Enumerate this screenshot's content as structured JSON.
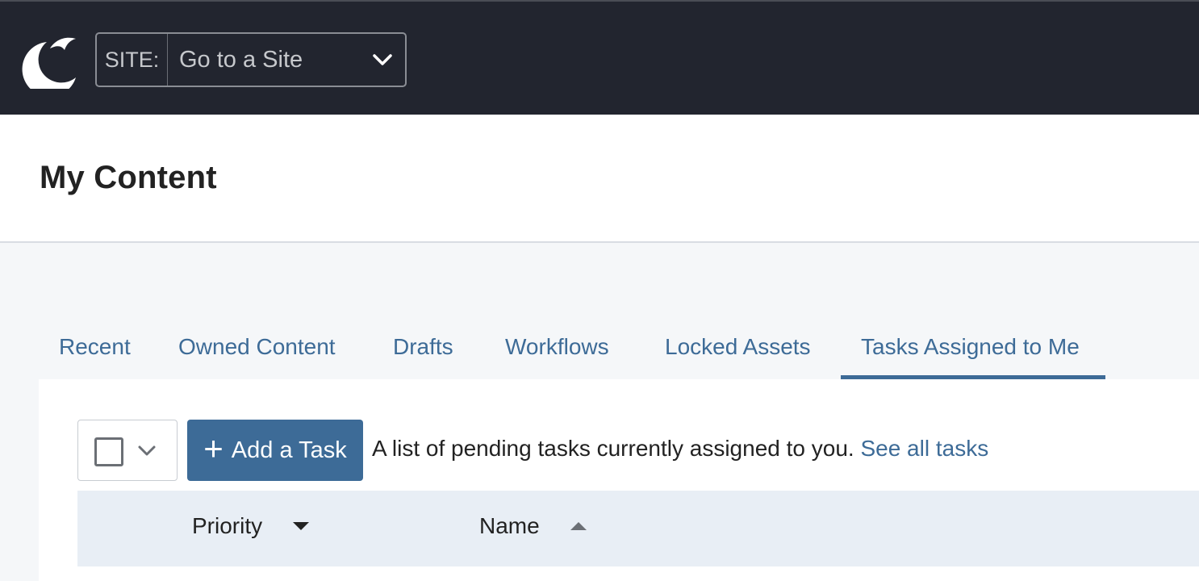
{
  "topbar": {
    "logo_icon": "crescent-bird-logo-icon",
    "site_label": "SITE:",
    "site_value": "Go to a Site",
    "site_chevron_icon": "chevron-down-icon"
  },
  "page": {
    "title": "My Content"
  },
  "tabs": [
    {
      "label": "Recent",
      "active": false
    },
    {
      "label": "Owned Content",
      "active": false
    },
    {
      "label": "Drafts",
      "active": false
    },
    {
      "label": "Workflows",
      "active": false
    },
    {
      "label": "Locked Assets",
      "active": false
    },
    {
      "label": "Tasks Assigned to Me",
      "active": true
    }
  ],
  "toolbar": {
    "checkbox_icon": "checkbox-icon",
    "select_chevron_icon": "chevron-down-icon",
    "add_task_icon": "plus-icon",
    "add_task_label": "Add a Task",
    "description": "A list of pending tasks currently assigned to you.",
    "see_all_link": "See all tasks"
  },
  "table": {
    "columns": [
      {
        "label": "Priority",
        "sort": "descending",
        "sort_icon": "caret-down-icon"
      },
      {
        "label": "Name",
        "sort": "ascending",
        "sort_icon": "caret-up-icon"
      }
    ]
  },
  "colors": {
    "topbar_bg": "#22252f",
    "accent": "#3d6b97",
    "table_header_bg": "#e8eef5",
    "page_bg": "#f5f7f9"
  }
}
